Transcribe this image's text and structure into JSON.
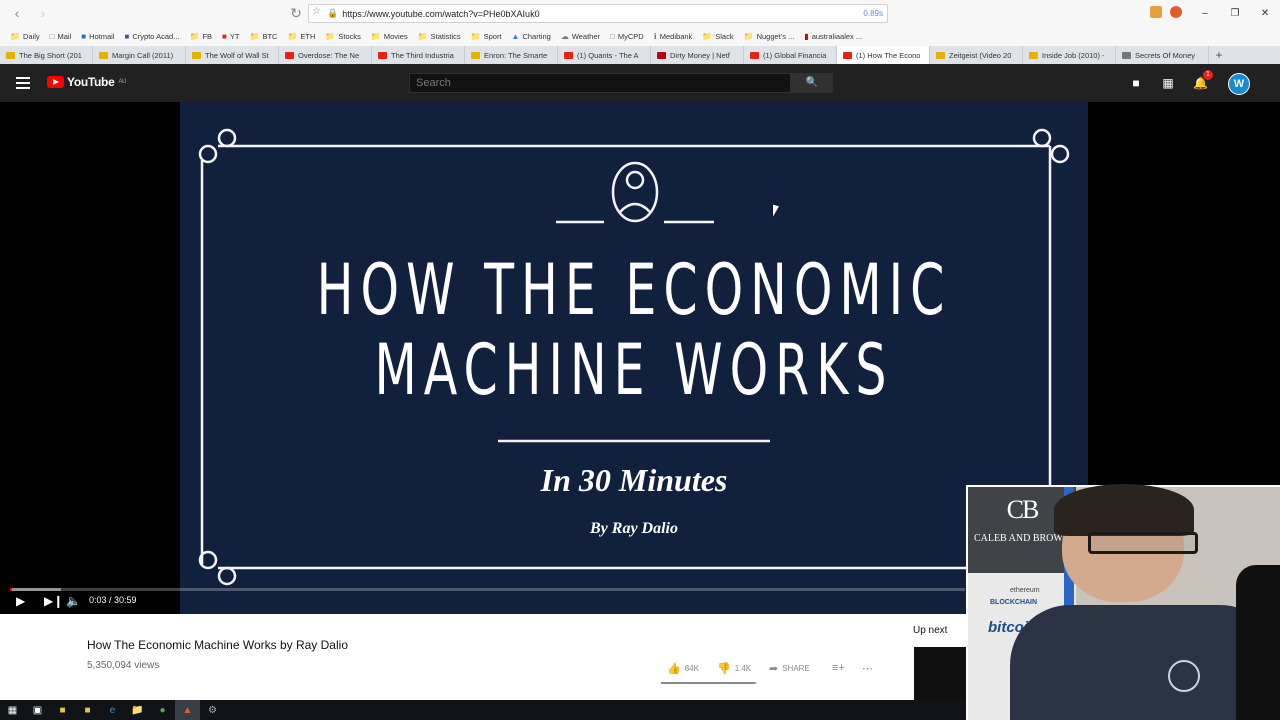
{
  "browser": {
    "url": "https://www.youtube.com/watch?v=PHe0bXAIuk0",
    "load_time": "0.89s",
    "bookmarks": [
      "Daily",
      "Mail",
      "Hotmail",
      "Crypto Acad...",
      "FB",
      "YT",
      "BTC",
      "ETH",
      "Stocks",
      "Movies",
      "Statistics",
      "Sport",
      "Charting",
      "Weather",
      "MyCPD",
      "Medibank",
      "Slack",
      "Nugget's ...",
      "australiaalex ..."
    ],
    "tabs": [
      {
        "label": "The Big Short (201",
        "color": "#e0b400"
      },
      {
        "label": "Margin Call (2011)",
        "color": "#e0b400"
      },
      {
        "label": "The Wolf of Wall St",
        "color": "#e0b400"
      },
      {
        "label": "Overdose: The Ne",
        "color": "#e62117"
      },
      {
        "label": "The Third Industria",
        "color": "#e62117"
      },
      {
        "label": "Enron: The Smarte",
        "color": "#e0b400"
      },
      {
        "label": "(1) Quants - The A",
        "color": "#e62117"
      },
      {
        "label": "Dirty Money | Netf",
        "color": "#b20710"
      },
      {
        "label": "(1) Global Financia",
        "color": "#e62117"
      },
      {
        "label": "(1) How The Econo",
        "color": "#e62117"
      },
      {
        "label": "Zeitgeist (Video 20",
        "color": "#e0b400"
      },
      {
        "label": "Inside Job (2010) -",
        "color": "#e0b400"
      },
      {
        "label": "Secrets Of Money",
        "color": "#777777"
      }
    ],
    "active_tab": 9
  },
  "youtube": {
    "logo_text": "YouTube",
    "region": "AU",
    "search_placeholder": "Search",
    "notification_count": "1",
    "avatar_letter": "W"
  },
  "video": {
    "title_line1": "HOW THE ECONOMIC",
    "title_line2": "MACHINE WORKS",
    "subtitle": "In 30 Minutes",
    "byline": "By Ray Dalio",
    "time": "0:03 / 30:59",
    "progress": 0.0016,
    "buffered": 0.053
  },
  "info": {
    "title": "How The Economic Machine Works by Ray Dalio",
    "views": "5,350,094 views",
    "likes": "84K",
    "dislikes": "1.4K",
    "share_label": "SHARE",
    "like_ratio": 0.98,
    "up_next": "Up next"
  },
  "webcam": {
    "banner_logo": "CB",
    "banner_name": "CALEB AND BROWN",
    "banner_sub": "ethereum",
    "banner_blockchain": "BLOCKCHAIN",
    "banner_bitcoin": "bitcoi"
  },
  "colors": {
    "yt_red": "#ff0000",
    "video_bg": "#11213d",
    "header_bg": "#212121"
  }
}
